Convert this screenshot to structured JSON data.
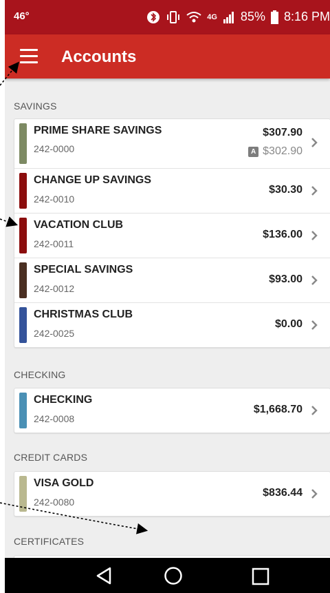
{
  "status_bar": {
    "temperature": "46°",
    "battery": "85%",
    "time": "8:16 PM",
    "network": "4G"
  },
  "app_bar": {
    "title": "Accounts",
    "menu_icon": "hamburger-menu-icon"
  },
  "sections": [
    {
      "title": "SAVINGS",
      "accounts": [
        {
          "name": "PRIME SHARE SAVINGS",
          "number": "242-0000",
          "balance": "$307.90",
          "available": "$302.90",
          "badge": "A",
          "color": "#7d8a63"
        },
        {
          "name": "CHANGE UP SAVINGS",
          "number": "242-0010",
          "balance": "$30.30",
          "color": "#8b0d0d"
        },
        {
          "name": "VACATION CLUB",
          "number": "242-0011",
          "balance": "$136.00",
          "color": "#8b0d0d"
        },
        {
          "name": "SPECIAL SAVINGS",
          "number": "242-0012",
          "balance": "$93.00",
          "color": "#4a2f22"
        },
        {
          "name": "CHRISTMAS CLUB",
          "number": "242-0025",
          "balance": "$0.00",
          "color": "#34539a"
        }
      ]
    },
    {
      "title": "CHECKING",
      "accounts": [
        {
          "name": "CHECKING",
          "number": "242-0008",
          "balance": "$1,668.70",
          "color": "#4a90b5"
        }
      ]
    },
    {
      "title": "CREDIT CARDS",
      "accounts": [
        {
          "name": "VISA GOLD",
          "number": "242-0080",
          "balance": "$836.44",
          "color": "#b9b88f"
        }
      ]
    },
    {
      "title": "CERTIFICATES",
      "accounts": []
    }
  ],
  "nav_bar": {
    "back_icon": "back-triangle-icon",
    "home_icon": "home-circle-icon",
    "recents_icon": "recents-square-icon"
  },
  "colors": {
    "status_bar": "#a8141c",
    "app_bar": "#cc2c24",
    "background": "#eeeeee",
    "nav_bar": "#000000"
  }
}
